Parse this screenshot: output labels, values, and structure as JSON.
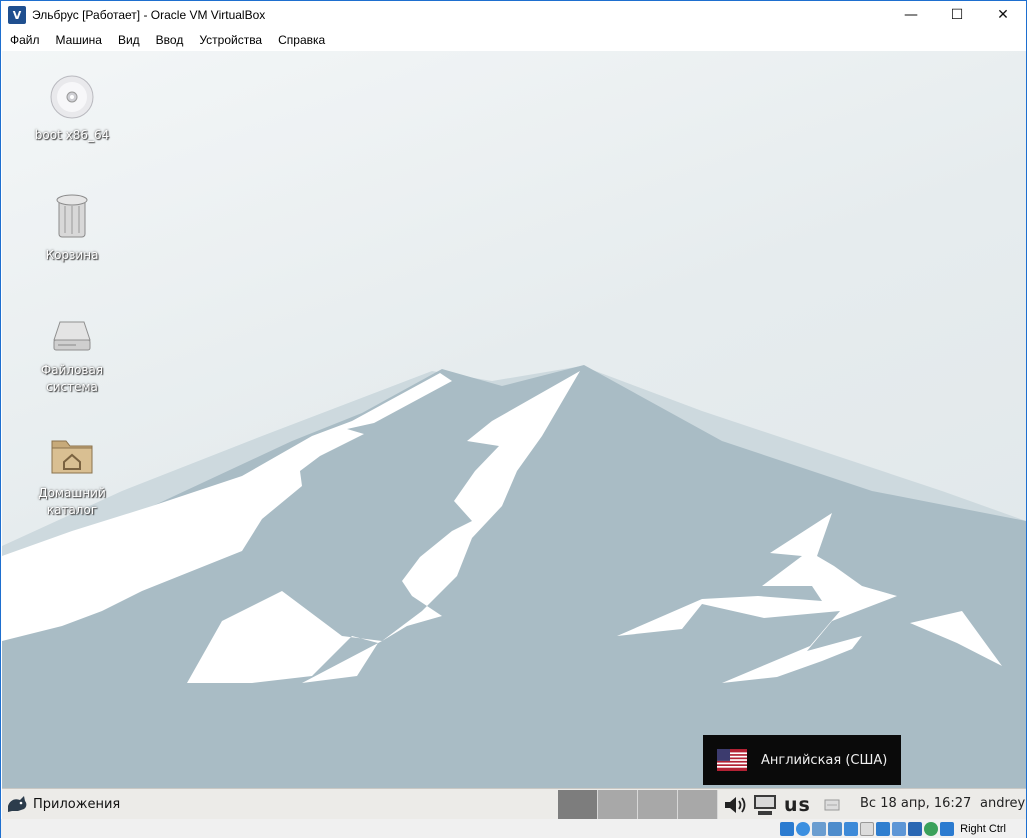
{
  "window": {
    "title": "Эльбрус [Работает] - Oracle VM VirtualBox",
    "minimize_glyph": "—",
    "maximize_glyph": "☐",
    "close_glyph": "✕"
  },
  "menubar": {
    "items": [
      "Файл",
      "Машина",
      "Вид",
      "Ввод",
      "Устройства",
      "Справка"
    ]
  },
  "desktop": {
    "icons": [
      {
        "label": "boot x86_64",
        "icon": "cdrom-icon"
      },
      {
        "label": "Корзина",
        "icon": "trash-icon"
      },
      {
        "label": "Файловая система",
        "icon": "drive-icon"
      },
      {
        "label": "Домашний каталог",
        "icon": "home-folder-icon"
      }
    ]
  },
  "osd": {
    "layout_label": "Английская (США)",
    "flag_icon": "us-flag-icon"
  },
  "taskbar": {
    "apps_label": "Приложения",
    "workspaces": 4,
    "active_workspace": 1,
    "keyboard_layout": "us",
    "clock": "Вс 18 апр, 16:27",
    "user": "andrey"
  },
  "statusbar": {
    "host_key": "Right Ctrl",
    "icons": [
      "hdd-icon",
      "optical-icon",
      "audio-icon",
      "network-icon",
      "usb-icon",
      "shared-folder-icon",
      "display-icon",
      "recording-icon",
      "cpu-icon",
      "mouse-integration-icon",
      "keyboard-icon"
    ]
  },
  "colors": {
    "titlebar_border": "#1e6fcf",
    "mountain_far": "#cdd9de",
    "mountain": "#a9bcc5",
    "snow": "#ffffff",
    "taskbar": "#ecebe8",
    "osd_bg": "#0a0a0a"
  }
}
